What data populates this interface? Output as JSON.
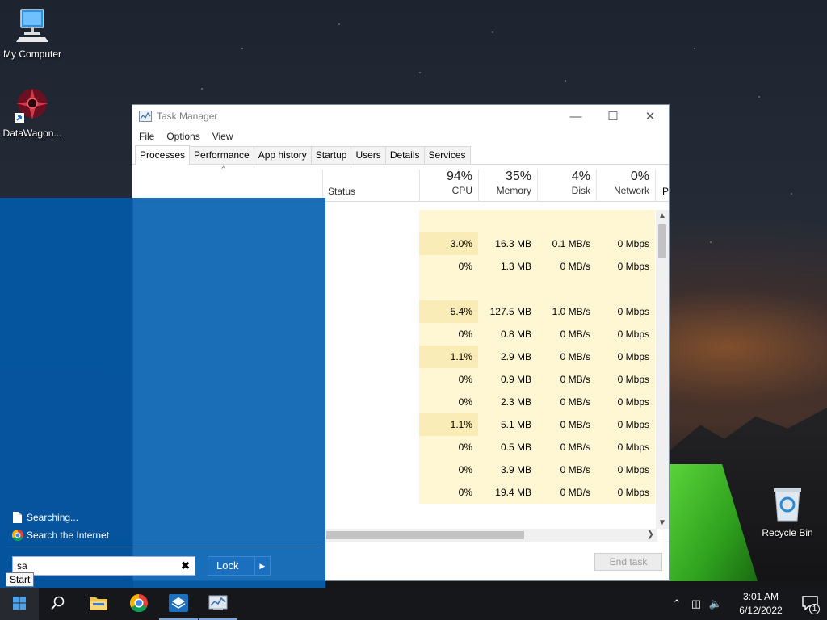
{
  "desktop": {
    "icons": [
      {
        "label": "My Computer"
      },
      {
        "label": "DataWagon..."
      },
      {
        "label": "Recycle Bin"
      }
    ]
  },
  "task_manager": {
    "title": "Task Manager",
    "menu": [
      "File",
      "Options",
      "View"
    ],
    "tabs": [
      "Processes",
      "Performance",
      "App history",
      "Startup",
      "Users",
      "Details",
      "Services"
    ],
    "active_tab": "Processes",
    "columns": {
      "status": "Status",
      "cpu": {
        "pct": "94%",
        "label": "CPU"
      },
      "memory": {
        "pct": "35%",
        "label": "Memory"
      },
      "disk": {
        "pct": "4%",
        "label": "Disk"
      },
      "network": {
        "pct": "0%",
        "label": "Network"
      },
      "power_truncated": "P"
    },
    "rows": [
      {
        "cpu": "",
        "memory": "",
        "disk": "",
        "network": ""
      },
      {
        "cpu": "3.0%",
        "memory": "16.3 MB",
        "disk": "0.1 MB/s",
        "network": "0 Mbps"
      },
      {
        "cpu": "0%",
        "memory": "1.3 MB",
        "disk": "0 MB/s",
        "network": "0 Mbps"
      },
      {
        "cpu": "",
        "memory": "",
        "disk": "",
        "network": ""
      },
      {
        "cpu": "5.4%",
        "memory": "127.5 MB",
        "disk": "1.0 MB/s",
        "network": "0 Mbps"
      },
      {
        "cpu": "0%",
        "memory": "0.8 MB",
        "disk": "0 MB/s",
        "network": "0 Mbps"
      },
      {
        "cpu": "1.1%",
        "memory": "2.9 MB",
        "disk": "0 MB/s",
        "network": "0 Mbps"
      },
      {
        "cpu": "0%",
        "memory": "0.9 MB",
        "disk": "0 MB/s",
        "network": "0 Mbps"
      },
      {
        "cpu": "0%",
        "memory": "2.3 MB",
        "disk": "0 MB/s",
        "network": "0 Mbps"
      },
      {
        "cpu": "1.1%",
        "memory": "5.1 MB",
        "disk": "0 MB/s",
        "network": "0 Mbps"
      },
      {
        "cpu": "0%",
        "memory": "0.5 MB",
        "disk": "0 MB/s",
        "network": "0 Mbps"
      },
      {
        "cpu": "0%",
        "memory": "3.9 MB",
        "disk": "0 MB/s",
        "network": "0 Mbps"
      },
      {
        "cpu": "0%",
        "memory": "19.4 MB",
        "disk": "0 MB/s",
        "network": "0 Mbps"
      }
    ],
    "end_task_label": "End task"
  },
  "start_panel": {
    "results": [
      {
        "label": "Searching...",
        "icon": "document-icon"
      },
      {
        "label": "Search the Internet",
        "icon": "chrome-icon"
      }
    ],
    "search_value": "sa",
    "lock_label": "Lock",
    "tooltip": "Start"
  },
  "taskbar": {
    "apps": [
      "start-icon",
      "search-icon",
      "file-explorer-icon",
      "chrome-icon",
      "app-icon",
      "task-manager-icon"
    ],
    "clock_time": "3:01 AM",
    "clock_date": "6/12/2022",
    "notification_count": "1"
  },
  "colors": {
    "accent_blue": "#0662b2",
    "heat_light": "#fff6d4",
    "taskbar": "#15171b"
  }
}
